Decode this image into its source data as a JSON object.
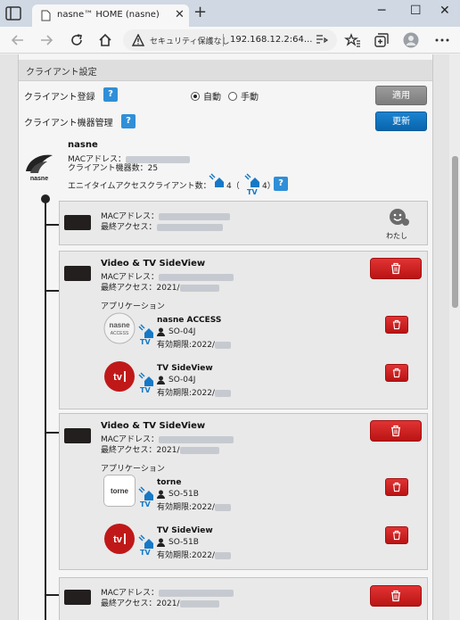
{
  "browser": {
    "tab_title": "nasne™ HOME (nasne)",
    "tab_close": "✕",
    "new_tab": "+",
    "window": {
      "minimize": "─",
      "maximize": "☐",
      "close": "✕"
    },
    "address": {
      "security_text": "セキュリティ保護なし",
      "url": "192.168.12.2:64..."
    }
  },
  "panel": {
    "header": "クライアント設定",
    "registration": {
      "label": "クライアント登録",
      "help": "?",
      "options": [
        "自動",
        "手動"
      ],
      "selected": "自動",
      "apply_label": "適用"
    },
    "device_mgmt": {
      "label": "クライアント機器管理",
      "help": "?",
      "refresh_label": "更新"
    },
    "nasne": {
      "name": "nasne",
      "logo_text": "nasne",
      "mac_label": "MACアドレス：",
      "client_count": "クライアント機器数：25",
      "anytime_label": "エニイタイムアクセスクライアント数：",
      "anytime_count_1": "4（",
      "anytime_count_2": "4）",
      "tv_label": "TV",
      "help": "?"
    },
    "self_device": {
      "mac_label": "MACアドレス：",
      "last_access_label": "最終アクセス：",
      "self_label": "わたし"
    },
    "devices": [
      {
        "title": "Video & TV SideView",
        "mac_label": "MACアドレス：",
        "last_access": "最終アクセス：2021/",
        "apps_label": "アプリケーション",
        "apps": [
          {
            "name": "nasne ACCESS",
            "device": "SO-04J",
            "expires": "有効期限:2022/",
            "icon_text": "nasne",
            "icon_sub": "ACCESS",
            "tv": "TV"
          },
          {
            "name": "TV SideView",
            "device": "SO-04J",
            "expires": "有効期限:2022/",
            "icon_text": "tv",
            "tv": "TV"
          }
        ]
      },
      {
        "title": "Video & TV SideView",
        "mac_label": "MACアドレス：",
        "last_access": "最終アクセス：2021/",
        "apps_label": "アプリケーション",
        "apps": [
          {
            "name": "torne",
            "device": "SO-51B",
            "expires": "有効期限:2022/",
            "icon_text": "torne",
            "tv": "TV"
          },
          {
            "name": "TV SideView",
            "device": "SO-51B",
            "expires": "有効期限:2022/",
            "icon_text": "tv",
            "tv": "TV"
          }
        ]
      }
    ],
    "last_device": {
      "mac_label": "MACアドレス：",
      "last_access": "最終アクセス：2021/"
    }
  },
  "colors": {
    "accent_blue": "#0a6fbd",
    "delete_red": "#c81d1d",
    "help_blue": "#2f8fd8",
    "tv_blue": "#1579c7"
  }
}
